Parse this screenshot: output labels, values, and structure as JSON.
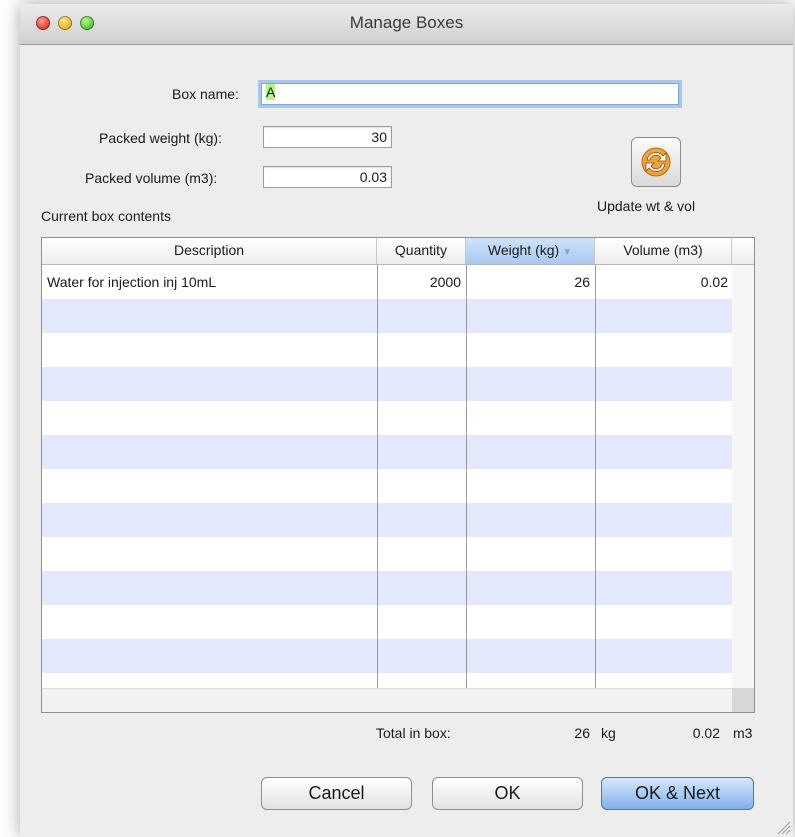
{
  "window": {
    "title": "Manage Boxes"
  },
  "form": {
    "box_name_label": "Box name:",
    "box_name_value": "A",
    "weight_label": "Packed weight (kg):",
    "weight_value": "30",
    "volume_label": "Packed volume (m3):",
    "volume_value": "0.03",
    "update_label": "Update wt & vol",
    "contents_label": "Current box contents"
  },
  "table": {
    "columns": [
      "Description",
      "Quantity",
      "Weight (kg)",
      "Volume (m3)"
    ],
    "sorted_column": "Weight (kg)",
    "sort_indicator": "▼",
    "rows": [
      {
        "description": "Water for injection inj 10mL",
        "quantity": "2000",
        "weight": "26",
        "volume": "0.02"
      }
    ]
  },
  "totals": {
    "label": "Total in box:",
    "weight": "26",
    "weight_unit": "kg",
    "volume": "0.02",
    "volume_unit": "m3"
  },
  "buttons": {
    "cancel": "Cancel",
    "ok": "OK",
    "ok_next": "OK & Next"
  },
  "colors": {
    "row_stripe": "#e3e8fb",
    "selection_highlight": "#b5f28a",
    "focus_ring": "#a9c6ec",
    "sorted_header": "#a9c9f2",
    "default_button": "#7fb0ea"
  }
}
